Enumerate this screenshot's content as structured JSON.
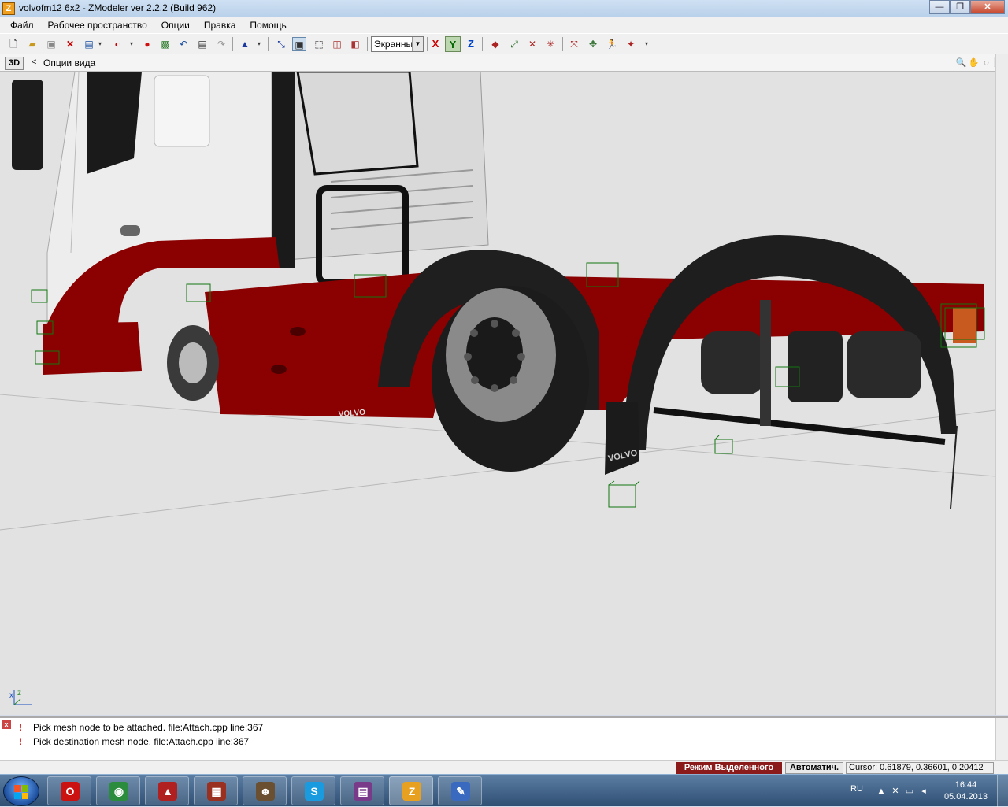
{
  "window": {
    "title": "volvofm12 6x2 - ZModeler ver 2.2.2 (Build 962)",
    "app_icon_letter": "Z",
    "minimize": "—",
    "maximize": "❐",
    "close": "✕"
  },
  "menu": {
    "items": [
      "Файл",
      "Рабочее пространство",
      "Опции",
      "Правка",
      "Помощь"
    ]
  },
  "toolbar": {
    "view_mode": "Экранны",
    "axis_x": "X",
    "axis_y": "Y",
    "axis_z": "Z",
    "axis_colors": {
      "x": "#cc0000",
      "y": "#006600",
      "z": "#0044cc"
    },
    "y_active": true
  },
  "view_header": {
    "mode_badge": "3D",
    "back": "<",
    "title": "Опции вида"
  },
  "viewport": {
    "background": "#e2e2e2",
    "brand_text": "VOLVO",
    "axis_x_label": "x",
    "axis_z_label": "z"
  },
  "log": {
    "lines": [
      {
        "icon": "!",
        "text": "Pick mesh node to be attached. file:Attach.cpp line:367"
      },
      {
        "icon": "!",
        "text": "Pick destination mesh node. file:Attach.cpp line:367"
      }
    ]
  },
  "status": {
    "mode": "Режим Выделенного",
    "auto": "Автоматич.",
    "cursor": "Cursor: 0.61879, 0.36601, 0.20412"
  },
  "taskbar": {
    "apps": [
      {
        "name": "opera",
        "label": "O",
        "color": "#cc1111"
      },
      {
        "name": "chrome",
        "label": "◉",
        "color": "#2a8c3c"
      },
      {
        "name": "truck-game",
        "label": "▲",
        "color": "#b02020"
      },
      {
        "name": "brick-app",
        "label": "▦",
        "color": "#9a3020"
      },
      {
        "name": "avatar-app",
        "label": "☻",
        "color": "#6a5030"
      },
      {
        "name": "skype",
        "label": "S",
        "color": "#1a9be0"
      },
      {
        "name": "winrar",
        "label": "▤",
        "color": "#7a3a8a"
      },
      {
        "name": "zmodeler",
        "label": "Z",
        "color": "#e8a020"
      },
      {
        "name": "paint",
        "label": "✎",
        "color": "#3a6ac0"
      }
    ],
    "language": "RU",
    "time": "16:44",
    "date": "05.04.2013"
  }
}
